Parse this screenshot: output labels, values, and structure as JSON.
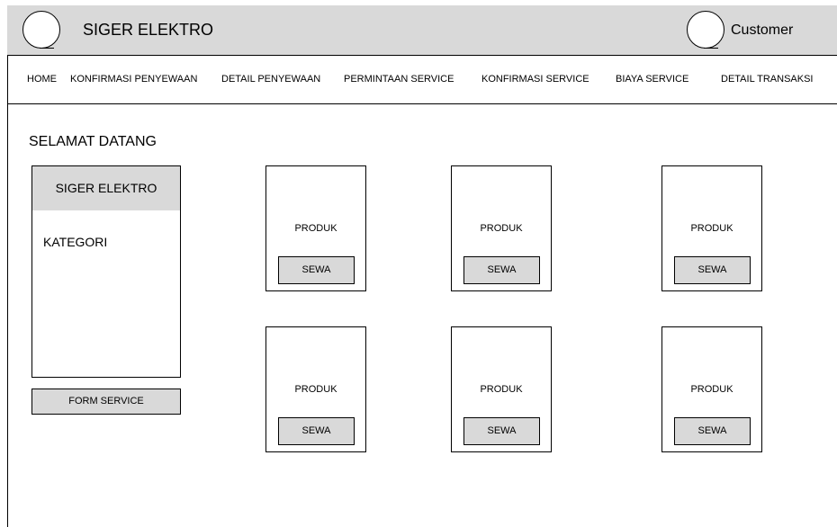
{
  "header": {
    "brand": "SIGER ELEKTRO",
    "user": "Customer",
    "logo_icon": "circle-logo-icon",
    "user_icon": "user-avatar-icon"
  },
  "nav": {
    "items": [
      "HOME",
      "KONFIRMASI PENYEWAAN",
      "DETAIL PENYEWAAN",
      "PERMINTAAN SERVICE",
      "KONFIRMASI SERVICE",
      "BIAYA SERVICE",
      "DETAIL TRANSAKSI"
    ]
  },
  "main": {
    "welcome": "SELAMAT DATANG"
  },
  "sidebar": {
    "title": "SIGER ELEKTRO",
    "category_label": "KATEGORI",
    "form_button": "FORM SERVICE"
  },
  "products": [
    {
      "label": "PRODUK",
      "button": "SEWA"
    },
    {
      "label": "PRODUK",
      "button": "SEWA"
    },
    {
      "label": "PRODUK",
      "button": "SEWA"
    },
    {
      "label": "PRODUK",
      "button": "SEWA"
    },
    {
      "label": "PRODUK",
      "button": "SEWA"
    },
    {
      "label": "PRODUK",
      "button": "SEWA"
    }
  ],
  "colors": {
    "header_bg": "#d9d9d9",
    "button_bg": "#d9d9d9",
    "border": "#000000"
  }
}
